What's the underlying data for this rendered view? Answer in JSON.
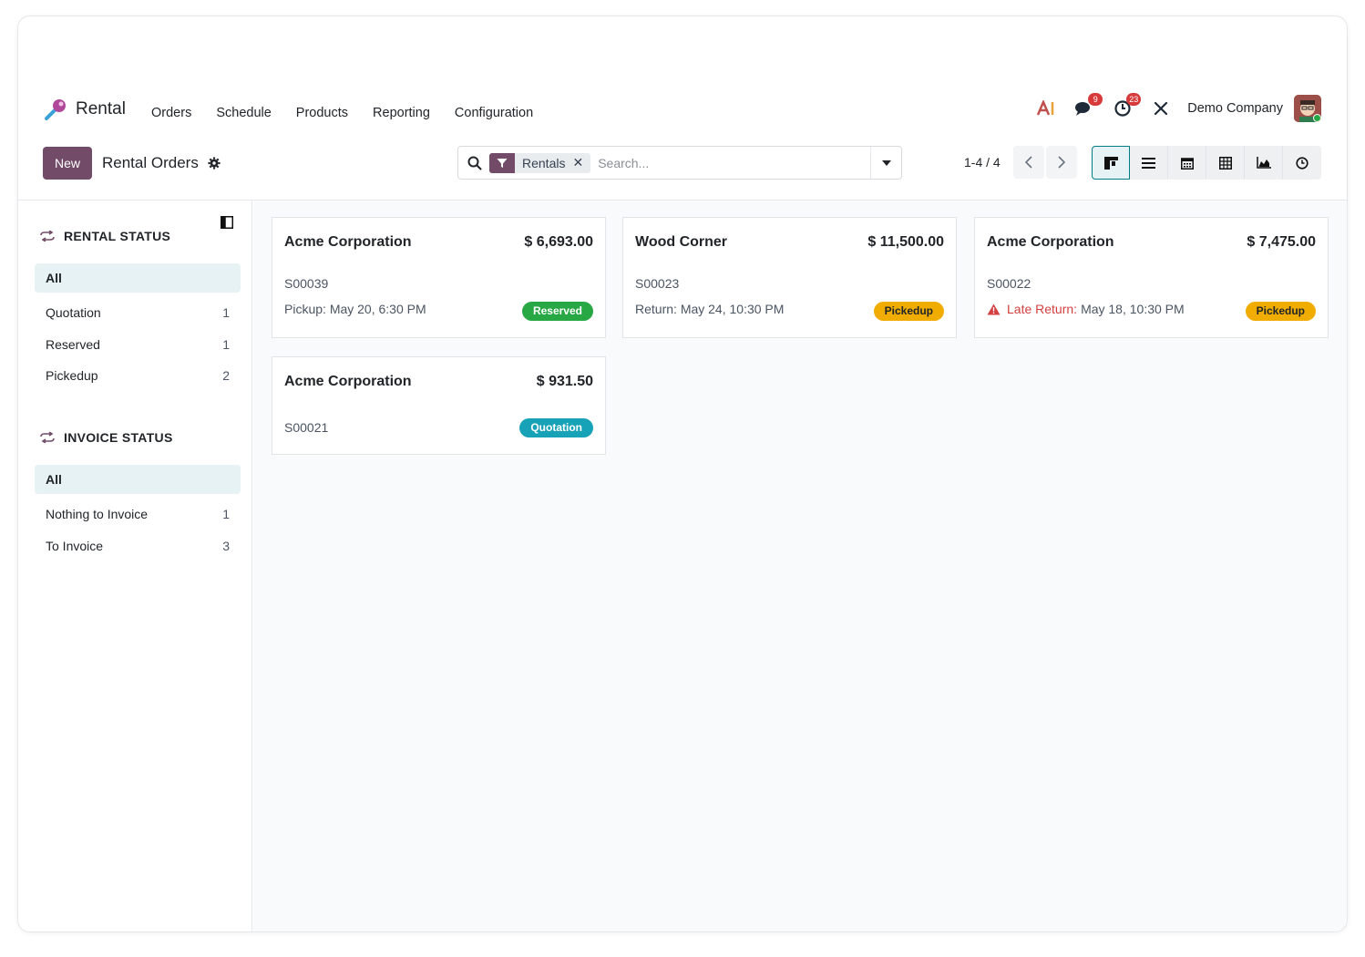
{
  "app": {
    "name": "Rental",
    "menu": [
      "Orders",
      "Schedule",
      "Products",
      "Reporting",
      "Configuration"
    ],
    "company": "Demo Company",
    "messages_count": "9",
    "activities_count": "23"
  },
  "control": {
    "new_label": "New",
    "title": "Rental Orders",
    "facet_label": "Rentals",
    "facet_close": "✕",
    "search_placeholder": "Search...",
    "pager": "1-4 / 4"
  },
  "sidebar": {
    "rental_status": {
      "title": "RENTAL STATUS",
      "items": [
        {
          "label": "All",
          "count": ""
        },
        {
          "label": "Quotation",
          "count": "1"
        },
        {
          "label": "Reserved",
          "count": "1"
        },
        {
          "label": "Pickedup",
          "count": "2"
        }
      ]
    },
    "invoice_status": {
      "title": "INVOICE STATUS",
      "items": [
        {
          "label": "All",
          "count": ""
        },
        {
          "label": "Nothing to Invoice",
          "count": "1"
        },
        {
          "label": "To Invoice",
          "count": "3"
        }
      ]
    }
  },
  "cards": [
    {
      "customer": "Acme Corporation",
      "amount": "$ 6,693.00",
      "ref": "S00039",
      "date_label": "Pickup:",
      "date_value": "May 20, 6:30 PM",
      "status": "Reserved"
    },
    {
      "customer": "Wood Corner",
      "amount": "$ 11,500.00",
      "ref": "S00023",
      "date_label": "Return:",
      "date_value": "May 24, 10:30 PM",
      "status": "Pickedup"
    },
    {
      "customer": "Acme Corporation",
      "amount": "$ 7,475.00",
      "ref": "S00022",
      "date_label": "Late Return:",
      "date_value": "May 18, 10:30 PM",
      "status": "Pickedup"
    },
    {
      "customer": "Acme Corporation",
      "amount": "$ 931.50",
      "ref": "S00021",
      "status": "Quotation"
    }
  ],
  "colors": {
    "brand": "#714b67",
    "accent": "#017e84",
    "reserved": "#28a745",
    "pickedup": "#f0ad00",
    "quotation": "#17a2b8",
    "late": "#d44040"
  }
}
